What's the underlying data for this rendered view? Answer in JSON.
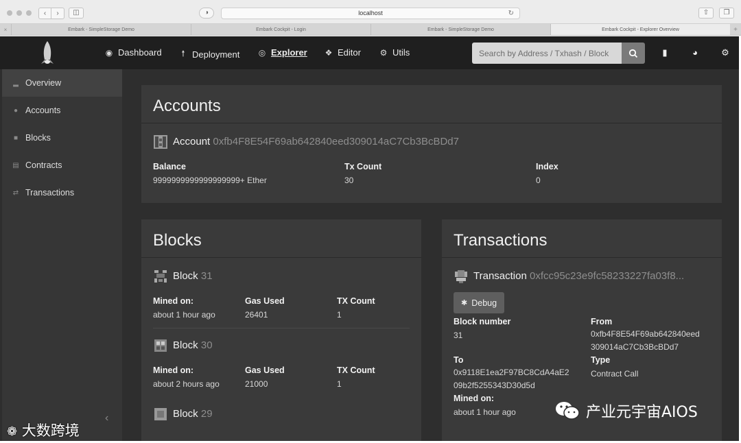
{
  "browser": {
    "url": "localhost",
    "tabs": [
      "Embark - SimpleStorage Demo",
      "Embark Cockpit - Login",
      "Embark - SimpleStorage Demo",
      "Embark Cockpit - Explorer Overview"
    ]
  },
  "header": {
    "nav": [
      {
        "label": "Dashboard",
        "icon": "dashboard-icon"
      },
      {
        "label": "Deployment",
        "icon": "upload-icon"
      },
      {
        "label": "Explorer",
        "icon": "compass-icon"
      },
      {
        "label": "Editor",
        "icon": "code-icon"
      },
      {
        "label": "Utils",
        "icon": "gear-icon"
      }
    ],
    "search_placeholder": "Search by Address / Txhash / Block"
  },
  "sidebar": {
    "items": [
      {
        "label": "Overview",
        "icon": "chart-icon"
      },
      {
        "label": "Accounts",
        "icon": "users-icon"
      },
      {
        "label": "Blocks",
        "icon": "cube-icon"
      },
      {
        "label": "Contracts",
        "icon": "file-icon"
      },
      {
        "label": "Transactions",
        "icon": "exchange-icon"
      }
    ]
  },
  "accounts": {
    "title": "Accounts",
    "item_prefix": "Account",
    "address": "0xfb4F8E54F69ab642840eed309014aC7Cb3BcBDd7",
    "balance_label": "Balance",
    "balance": "9999999999999999999+ Ether",
    "txcount_label": "Tx Count",
    "txcount": "30",
    "index_label": "Index",
    "index": "0"
  },
  "blocks": {
    "title": "Blocks",
    "item_prefix": "Block",
    "mined_label": "Mined on:",
    "gas_label": "Gas Used",
    "tx_label": "TX Count",
    "items": [
      {
        "number": "31",
        "mined": "about 1 hour ago",
        "gas": "26401",
        "tx": "1"
      },
      {
        "number": "30",
        "mined": "about 2 hours ago",
        "gas": "21000",
        "tx": "1"
      },
      {
        "number": "29"
      }
    ]
  },
  "transactions": {
    "title": "Transactions",
    "item_prefix": "Transaction",
    "hash": "0xfcc95c23e9fc58233227fa03f8...",
    "debug_label": "Debug",
    "block_label": "Block number",
    "block": "31",
    "from_label": "From",
    "from_line1": "0xfb4F8E54F69ab642840eed",
    "from_line2": "309014aC7Cb3BcBDd7",
    "to_label": "To",
    "to_line1": "0x9118E1ea2F97BC8CdA4aE2",
    "to_line2": "09b2f5255343D30d5d",
    "type_label": "Type",
    "type": "Contract Call",
    "mined_label": "Mined on:",
    "mined": "about 1 hour ago"
  },
  "watermarks": {
    "left": "大数跨境",
    "right": "产业元宇宙AIOS"
  }
}
